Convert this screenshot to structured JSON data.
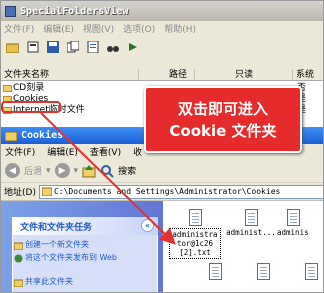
{
  "top_window": {
    "title": "SpecialFoldersView",
    "menu": [
      "文件(F)",
      "编辑(E)",
      "视图(V)",
      "选项(O)",
      "帮助(H)"
    ],
    "columns": [
      "文件夹名称",
      "路径",
      "只读",
      "系统"
    ],
    "rows": [
      {
        "name": "CD刻录",
        "sys": "否"
      },
      {
        "name": "Cookies",
        "sys": "是"
      },
      {
        "name": "Internet临时文件",
        "sys": "是"
      }
    ]
  },
  "callout": {
    "line1": "双击即可进入",
    "line2": "Cookie 文件夹"
  },
  "bottom_window": {
    "title": "Cookies",
    "menu": [
      "文件(F)",
      "编辑(E)",
      "查看(V)",
      "收"
    ],
    "back_label": "后退",
    "search_label": "搜索",
    "address_label": "地址(D)",
    "address_value": "C:\\Documents and Settings\\Administrator\\Cookies",
    "task_panel": {
      "title": "文件和文件夹任务",
      "links": [
        "创建一个新文件夹",
        "将这个文件夹发布到 Web",
        "共享此文件夹"
      ]
    },
    "files": [
      "administrator@1c26[2].txt",
      "administ...",
      "adminis"
    ]
  },
  "colors": {
    "callout": "#e52b2b",
    "highlight": "#e53030",
    "task_link": "#215dc6"
  }
}
